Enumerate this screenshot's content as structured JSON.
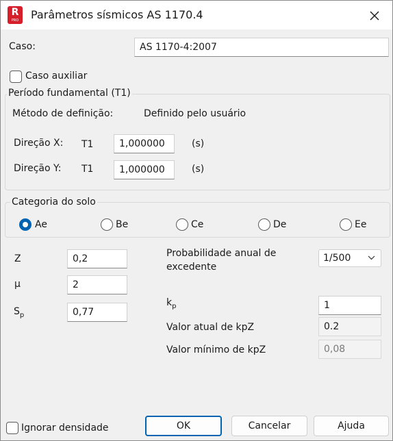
{
  "window": {
    "title": "Parâmetros sísmicos AS 1170.4"
  },
  "caso": {
    "label": "Caso:",
    "value": "AS 1170-4:2007"
  },
  "caso_auxiliar": {
    "label": "Caso auxiliar",
    "checked": false
  },
  "periodo": {
    "legend": "Período fundamental (T1)",
    "metodo_label": "Método de definição:",
    "metodo_value": "Definido pelo usuário",
    "dir_x": {
      "label": "Direção X:",
      "symbol": "T1",
      "value": "1,000000",
      "unit": "(s)"
    },
    "dir_y": {
      "label": "Direção Y:",
      "symbol": "T1",
      "value": "1,000000",
      "unit": "(s)"
    }
  },
  "solo": {
    "legend": "Categoria do solo",
    "options": [
      "Ae",
      "Be",
      "Ce",
      "De",
      "Ee"
    ],
    "selected": "Ae"
  },
  "params": {
    "z": {
      "label": "Z",
      "value": "0,2"
    },
    "mu": {
      "label": "μ",
      "value": "2"
    },
    "sp": {
      "label": "S",
      "sub": "p",
      "value": "0,77"
    }
  },
  "probabilidade": {
    "label_line1": "Probabilidade anual de",
    "label_line2": "excedente",
    "value": "1/500"
  },
  "kp": {
    "label": "k",
    "sub": "p",
    "value": "1"
  },
  "kpz_atual": {
    "label": "Valor atual de kpZ",
    "value": "0.2"
  },
  "kpz_minimo": {
    "label": "Valor mínimo de kpZ",
    "value": "0,08"
  },
  "ignorar_densidade": {
    "label": "Ignorar densidade",
    "checked": false
  },
  "buttons": {
    "ok": "OK",
    "cancel": "Cancelar",
    "help": "Ajuda"
  },
  "colors": {
    "accent": "#0063b1",
    "app_icon": "#d71e2b"
  }
}
